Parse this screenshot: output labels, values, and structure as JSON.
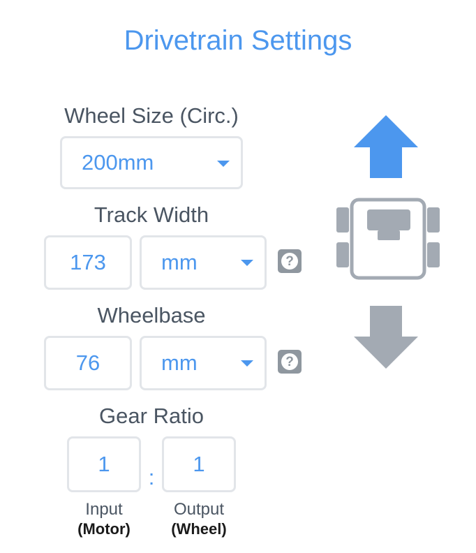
{
  "title": "Drivetrain Settings",
  "wheel_size": {
    "label": "Wheel Size (Circ.)",
    "value": "200mm"
  },
  "track_width": {
    "label": "Track Width",
    "value": "173",
    "unit": "mm"
  },
  "wheelbase": {
    "label": "Wheelbase",
    "value": "76",
    "unit": "mm"
  },
  "gear_ratio": {
    "label": "Gear Ratio",
    "input_value": "1",
    "output_value": "1",
    "separator": ":",
    "input_label": "Input",
    "input_sub": "(Motor)",
    "output_label": "Output",
    "output_sub": "(Wheel)"
  },
  "help_glyph": "?",
  "icons": [
    "chevron-down-icon",
    "help-icon",
    "forward-arrow-icon",
    "robot-top-view-icon",
    "reverse-arrow-icon"
  ],
  "colors": {
    "accent": "#4c97ee",
    "muted_icon": "#a3aab3",
    "text": "#4a5562",
    "border": "#e2e5e9"
  }
}
